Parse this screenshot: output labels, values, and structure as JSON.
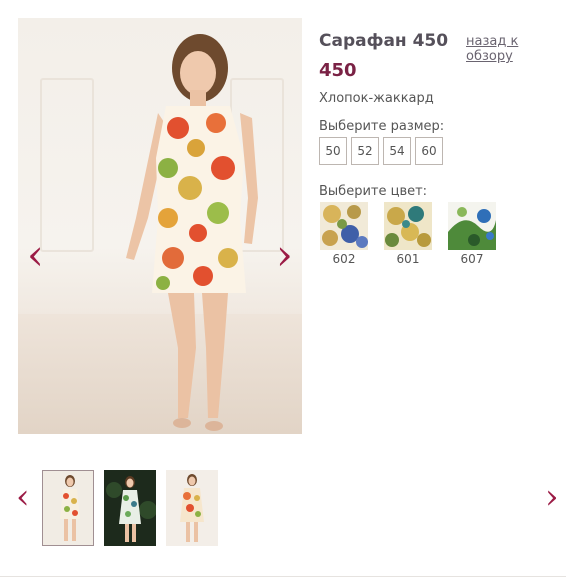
{
  "product": {
    "title": "Сарафан 450",
    "price": "450",
    "material": "Хлопок-жаккард",
    "back_link": "назад к обзору"
  },
  "gallery": {
    "prev_icon": "‹",
    "next_icon": "›",
    "main_image": "model-in-floral-sundress",
    "thumbnails": [
      {
        "image": "floral-sundress-front",
        "active": true
      },
      {
        "image": "green-floral-sundress-dark-background",
        "active": false
      },
      {
        "image": "orange-floral-sundress",
        "active": false
      }
    ]
  },
  "size_selector": {
    "label": "Выберите размер:",
    "sizes": [
      "50",
      "52",
      "54",
      "60"
    ]
  },
  "color_selector": {
    "label": "Выберите цвет:",
    "colors": [
      {
        "code": "602",
        "image": "floral-swatch-blue-yellow"
      },
      {
        "code": "601",
        "image": "floral-swatch-yellow-teal"
      },
      {
        "code": "607",
        "image": "floral-swatch-green-blue"
      }
    ]
  },
  "theme": {
    "accent": "#9b1b45",
    "price_color": "#7a2245"
  }
}
